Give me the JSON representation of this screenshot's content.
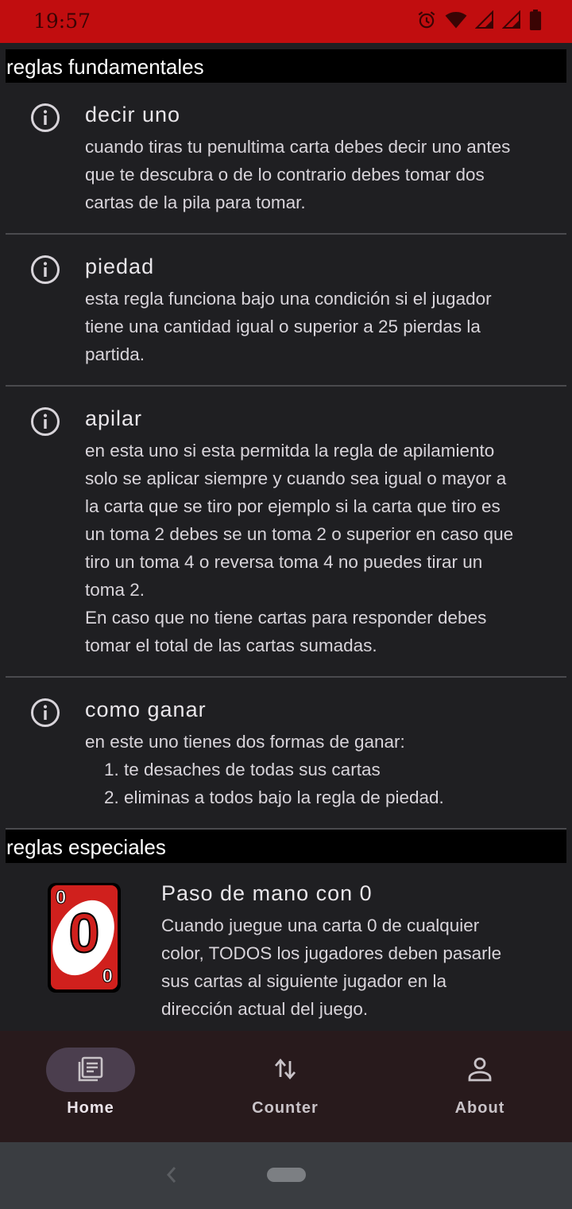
{
  "status_bar": {
    "time": "19:57",
    "icons": [
      "alarm-icon",
      "wifi-icon",
      "signal-icon",
      "signal-icon",
      "battery-icon"
    ],
    "background": "#c10d0f"
  },
  "sections": {
    "fundamental": {
      "header": "reglas fundamentales"
    },
    "special": {
      "header": "reglas especiales"
    }
  },
  "rules": [
    {
      "icon": "info-icon",
      "title": "decir uno",
      "lines": [
        "cuando tiras tu penultima carta debes decir uno antes",
        "que te descubra o de lo contrario debes tomar dos",
        "cartas de la pila para tomar."
      ]
    },
    {
      "icon": "info-icon",
      "title": "piedad",
      "lines": [
        "esta regla funciona bajo una condición si el jugador",
        "tiene una cantidad igual o superior a 25 pierdas la",
        "partida."
      ]
    },
    {
      "icon": "info-icon",
      "title": "apilar",
      "lines": [
        "en esta uno si esta permitda la regla de apilamiento",
        "solo se aplicar siempre y cuando sea igual o mayor a",
        "la carta que se tiro por ejemplo si la carta que tiro es",
        "un toma 2 debes se un toma 2 o superior en caso que",
        "tiro un toma 4 o reversa toma 4 no puedes tirar un",
        "toma 2.",
        "En caso que no tiene cartas para responder debes",
        "tomar el total de las cartas sumadas."
      ]
    },
    {
      "icon": "info-icon",
      "title": "como ganar",
      "lines": [
        "en este uno tienes dos formas de ganar:"
      ],
      "list": [
        "1. te desaches de todas sus cartas",
        "2. eliminas a todos bajo la regla de piedad."
      ]
    }
  ],
  "special_rule": {
    "card": {
      "value": "0",
      "color": "#d0201d"
    },
    "title": "Paso de mano con 0",
    "lines": [
      "Cuando juegue una carta 0 de cualquier",
      "color, TODOS los jugadores deben pasarle",
      "sus cartas al siguiente jugador en la",
      "dirección actual del juego."
    ]
  },
  "bottom_nav": {
    "items": [
      {
        "label": "Home",
        "icon": "article-icon",
        "active": true
      },
      {
        "label": "Counter",
        "icon": "swap-vertical-icon",
        "active": false
      },
      {
        "label": "About",
        "icon": "person-icon",
        "active": false
      }
    ]
  },
  "colors": {
    "background": "#1f1f22",
    "section_header": "#000000",
    "nav_background": "#281a1c",
    "nav_active_pill": "#4b3e4e"
  }
}
